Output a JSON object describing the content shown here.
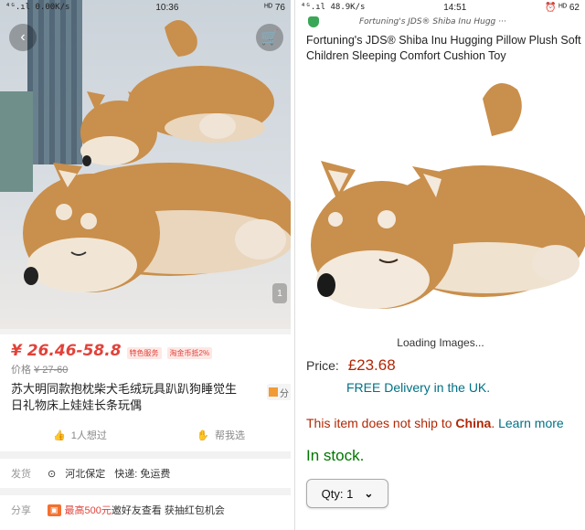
{
  "left": {
    "status_signal": "⁴ᴳ.ıl 0.00K/s",
    "status_time": "10:36",
    "status_right": "ᴴᴰ 76",
    "price": "¥ 26.46-58.8",
    "tag1": "特色服务",
    "tag2": "淘金币抵2%",
    "orig_label": "价格",
    "orig_price": "¥ 27-60",
    "title": "苏大明同款抱枕柴犬毛绒玩具趴趴狗睡觉生日礼物床上娃娃长条玩偶",
    "side_badge": "分",
    "want_label": "1人想过",
    "collect_label": "帮我选",
    "ship_key": "发货",
    "ship_from": "河北保定",
    "express": "快递: 免运费",
    "promo_key": "分享",
    "promo_highlight": "最高500元",
    "promo_text": "邀好友查看 获抽红包机会",
    "pager": "1"
  },
  "right": {
    "status_signal": "⁴ᴳ.ıl 48.9K/s",
    "status_time": "14:51",
    "status_right": "⏰ ᴴᴰ 62",
    "seller": "Fortuning's JDS® Shiba Inu Hugg ···",
    "title_line1": "Fortuning's JDS® Shiba Inu Hugging Pillow Plush Soft",
    "title_line2": "Children Sleeping Comfort Cushion Toy",
    "loading": "Loading Images...",
    "price_label": "Price:",
    "price": "£23.68",
    "delivery": "FREE Delivery in the UK.",
    "noship_pre": "This item does not ship to ",
    "noship_country": "China",
    "noship_post": ". ",
    "learn_more": "Learn more",
    "stock": "In stock.",
    "qty_label": "Qty: 1"
  },
  "colors": {
    "taobao_red": "#e1423a",
    "amazon_price": "#b12704",
    "amazon_link": "#007185",
    "in_stock": "#007600"
  }
}
